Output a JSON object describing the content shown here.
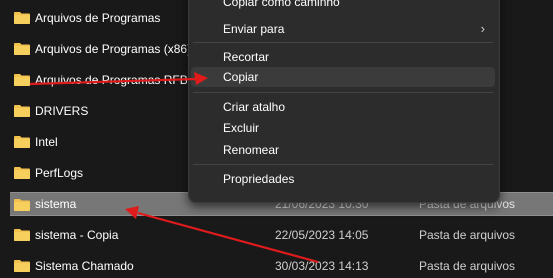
{
  "files": [
    {
      "name": "Arquivos de Programas",
      "date": "",
      "type": ""
    },
    {
      "name": "Arquivos de Programas (x86)",
      "date": "",
      "type": ""
    },
    {
      "name": "Arquivos de Programas RFB",
      "date": "",
      "type": ""
    },
    {
      "name": "DRIVERS",
      "date": "",
      "type": ""
    },
    {
      "name": "Intel",
      "date": "",
      "type": ""
    },
    {
      "name": "PerfLogs",
      "date": "",
      "type": ""
    },
    {
      "name": "sistema",
      "date": "21/06/2023 10:30",
      "type": "Pasta de arquivos",
      "selected": true
    },
    {
      "name": "sistema - Copia",
      "date": "22/05/2023 14:05",
      "type": "Pasta de arquivos"
    },
    {
      "name": "Sistema Chamado",
      "date": "30/03/2023 14:13",
      "type": "Pasta de arquivos"
    }
  ],
  "context_menu": {
    "items": [
      {
        "label": "Copiar como caminho"
      },
      {
        "label": "Enviar para",
        "submenu": true
      },
      {
        "label": "Recortar"
      },
      {
        "label": "Copiar",
        "highlighted": true
      },
      {
        "label": "Criar atalho"
      },
      {
        "label": "Excluir"
      },
      {
        "label": "Renomear"
      },
      {
        "label": "Propriedades"
      }
    ]
  },
  "colors": {
    "background": "#191919",
    "folder_icon": "#f2c14e",
    "annotation_arrow": "#e01b1b",
    "selected_row": "#777777"
  }
}
